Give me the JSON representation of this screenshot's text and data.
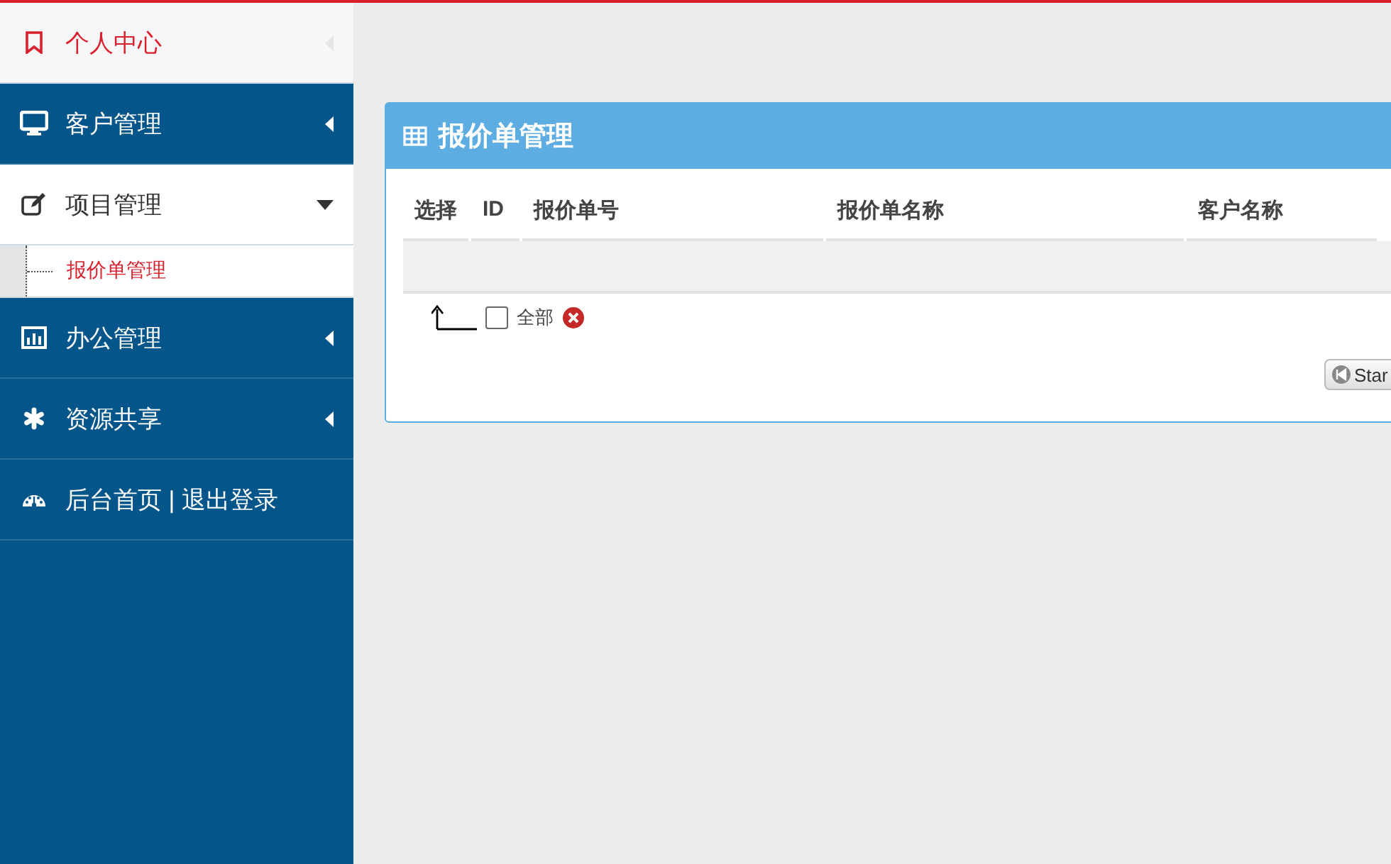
{
  "sidebar": {
    "items": [
      {
        "label": "个人中心",
        "kind": "menu",
        "selected": true,
        "expanded": false
      },
      {
        "label": "客户管理",
        "kind": "menu",
        "selected": false,
        "expanded": false
      },
      {
        "label": "项目管理",
        "kind": "menu",
        "selected": false,
        "expanded": true,
        "children": [
          {
            "label": "报价单管理",
            "selected": true
          }
        ]
      },
      {
        "label": "办公管理",
        "kind": "menu",
        "selected": false,
        "expanded": false
      },
      {
        "label": "资源共享",
        "kind": "menu",
        "selected": false,
        "expanded": false
      },
      {
        "label": "后台首页 | 退出登录",
        "kind": "link",
        "selected": false,
        "expanded": false
      }
    ]
  },
  "panel": {
    "title": "报价单管理",
    "table": {
      "columns": [
        "选择",
        "ID",
        "报价单号",
        "报价单名称",
        "客户名称"
      ]
    },
    "footer": {
      "select_all": {
        "label": "全部",
        "checked": false
      }
    },
    "pager": {
      "start_button": "Star"
    }
  }
}
